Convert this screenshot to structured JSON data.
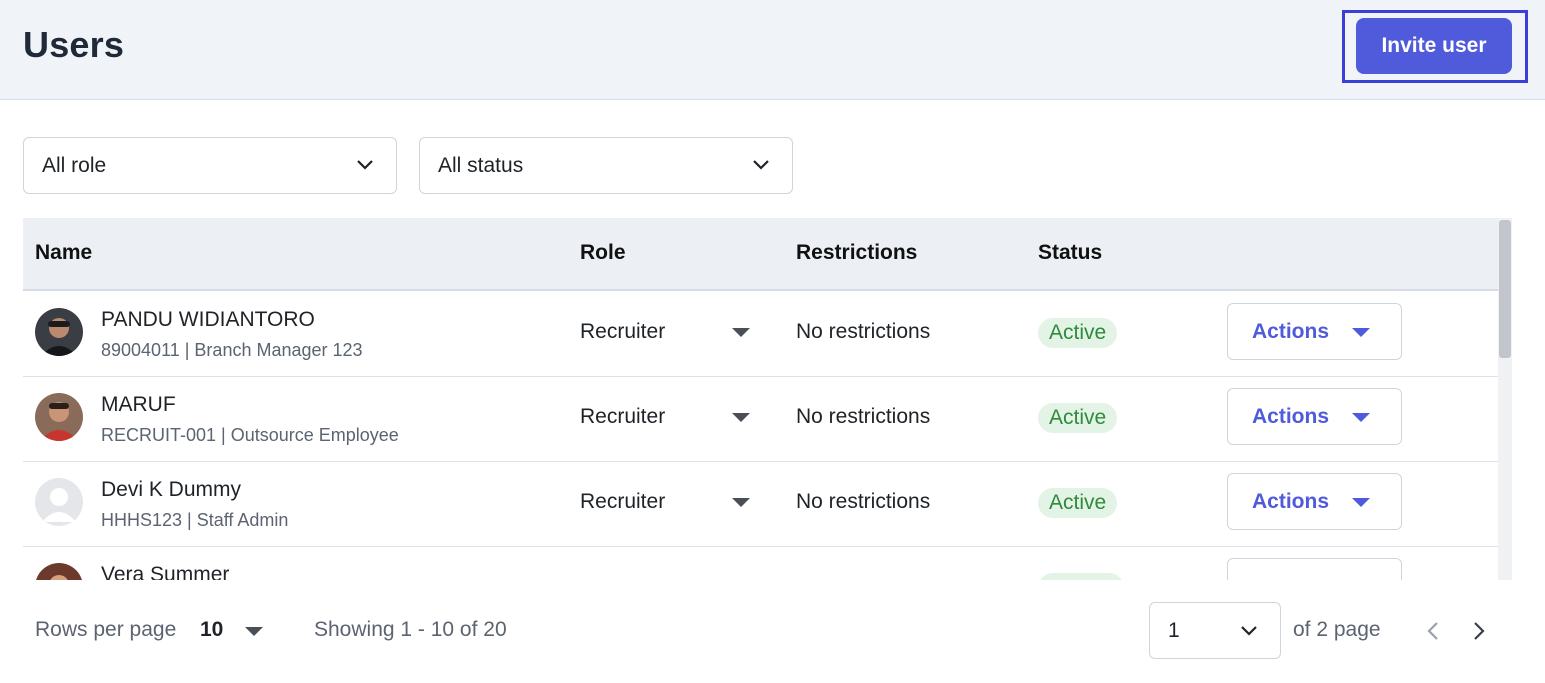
{
  "header": {
    "title": "Users",
    "invite_label": "Invite user"
  },
  "filters": {
    "role_value": "All role",
    "status_value": "All status"
  },
  "table": {
    "columns": [
      "Name",
      "Role",
      "Restrictions",
      "Status"
    ],
    "rows": [
      {
        "name": "PANDU WIDIANTORO",
        "sub": "89004011 | Branch Manager 123",
        "role": "Recruiter",
        "restrictions": "No restrictions",
        "status": "Active",
        "action": "Actions"
      },
      {
        "name": "MARUF",
        "sub": "RECRUIT-001 | Outsource Employee",
        "role": "Recruiter",
        "restrictions": "No restrictions",
        "status": "Active",
        "action": "Actions"
      },
      {
        "name": "Devi K Dummy",
        "sub": "HHHS123 | Staff Admin",
        "role": "Recruiter",
        "restrictions": "No restrictions",
        "status": "Active",
        "action": "Actions"
      },
      {
        "name": "Vera Summer",
        "sub": "",
        "role": "",
        "restrictions": "",
        "status": "",
        "action": ""
      }
    ]
  },
  "footer": {
    "rows_per_page_label": "Rows per page",
    "rows_per_page_value": "10",
    "showing_text": "Showing 1 - 10 of 20",
    "current_page": "1",
    "of_pages_text": "of 2 page"
  },
  "colors": {
    "accent": "#4f5bdb",
    "header_bg": "#f0f3f8",
    "active_badge_bg": "#e3f4e6",
    "active_badge_text": "#2f8a3c"
  },
  "icons": [
    "chevron-down-icon",
    "caret-down-icon",
    "chevron-left-icon",
    "chevron-right-icon",
    "avatar-placeholder-icon"
  ]
}
